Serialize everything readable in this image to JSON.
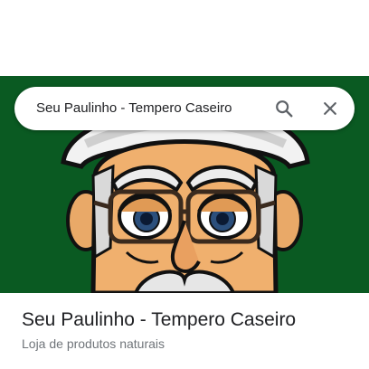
{
  "search": {
    "query": "Seu Paulinho - Tempero Caseiro",
    "search_icon": "search-icon",
    "close_icon": "close-icon"
  },
  "hero": {
    "image": "cartoon-mascot-portrait",
    "background_color": "#0a5a22"
  },
  "place": {
    "title": "Seu Paulinho - Tempero Caseiro",
    "category": "Loja de produtos naturais"
  }
}
